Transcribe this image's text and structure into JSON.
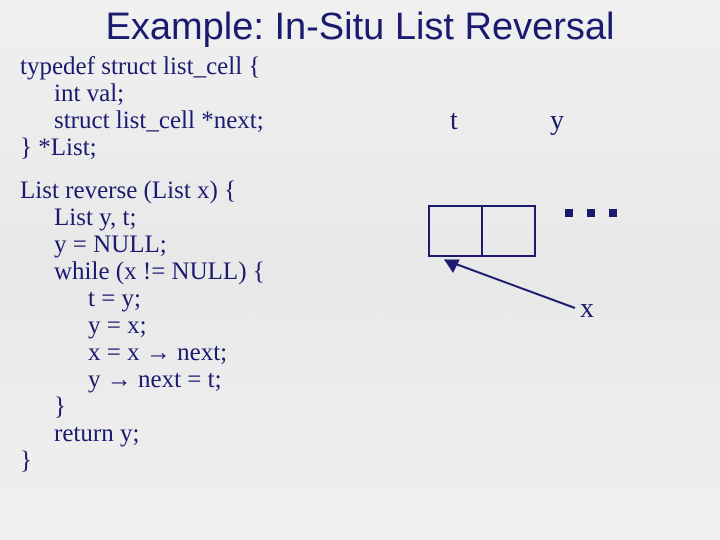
{
  "title": "Example: In-Situ List Reversal",
  "typedef": {
    "l1": "typedef struct list_cell {",
    "l2": "int val;",
    "l3": "struct list_cell *next;",
    "l4": "} *List;"
  },
  "func": {
    "l1": "List reverse (List x) {",
    "l2": "List y, t;",
    "l3": "y = NULL;",
    "l4": "while (x != NULL) {",
    "l5": "t = y;",
    "l6": "y = x;",
    "l7a": "x = x ",
    "l7b": " next;",
    "l8a": "y ",
    "l8b": " next = t;",
    "l9": "}",
    "l10": "return y;",
    "l11": "}"
  },
  "arrow_glyph": "→",
  "diagram": {
    "t": "t",
    "y": "y",
    "x": "x"
  }
}
